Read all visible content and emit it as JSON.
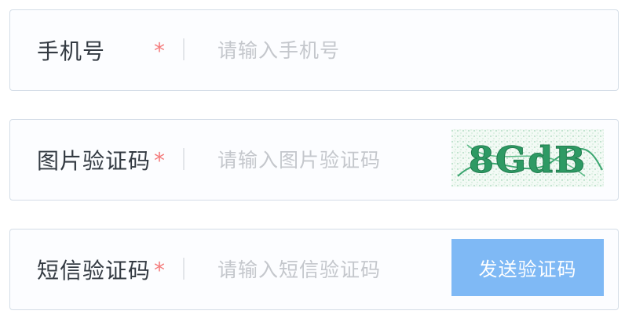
{
  "form": {
    "phone": {
      "label": "手机号",
      "required_mark": "*",
      "placeholder": "请输入手机号",
      "value": ""
    },
    "image_captcha": {
      "label": "图片验证码",
      "required_mark": "*",
      "placeholder": "请输入图片验证码",
      "value": "",
      "captcha_text": "8GdB"
    },
    "sms_code": {
      "label": "短信验证码",
      "required_mark": "*",
      "placeholder": "请输入短信验证码",
      "value": "",
      "send_button_label": "发送验证码"
    }
  },
  "colors": {
    "required": "#f47c7c",
    "button": "#7fb9f5",
    "captcha_text": "#2e9a64",
    "border": "#d4dde7",
    "placeholder": "#c4c7cc"
  }
}
